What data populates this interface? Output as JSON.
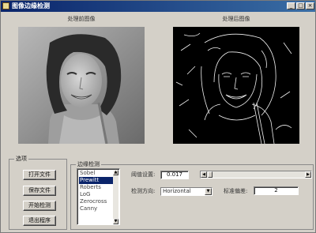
{
  "window": {
    "title": "图像边缘检测",
    "controls": {
      "minimize": "_",
      "maximize": "□",
      "close": "×"
    }
  },
  "images": {
    "original_caption": "处理前图像",
    "processed_caption": "处理后图像"
  },
  "options": {
    "legend": "选项",
    "buttons": {
      "open_file": "打开文件",
      "save_file": "保存文件",
      "start_detect": "开始检测",
      "exit": "退出程序"
    }
  },
  "edge_detection": {
    "legend": "边缘检测",
    "methods": [
      "Sobel",
      "Prewitt",
      "Roberts",
      "LoG",
      "Zerocross",
      "Canny"
    ],
    "selected_method": "Prewitt",
    "threshold_label": "阈值设置:",
    "threshold_value": "0.017",
    "threshold_slider_fraction": 0.0,
    "direction_label": "检测方向:",
    "direction_value": "Horizontal",
    "sigma_label": "标准偏差:",
    "sigma_value": "2"
  },
  "icons": {
    "list_up": "▲",
    "list_down": "▼",
    "slider_left": "◀",
    "slider_right": "▶",
    "dropdown": "▼"
  },
  "colors": {
    "titlebar_start": "#0a246a",
    "titlebar_end": "#3a6ea5",
    "window_bg": "#d4d0c8",
    "selection": "#0a246a"
  }
}
